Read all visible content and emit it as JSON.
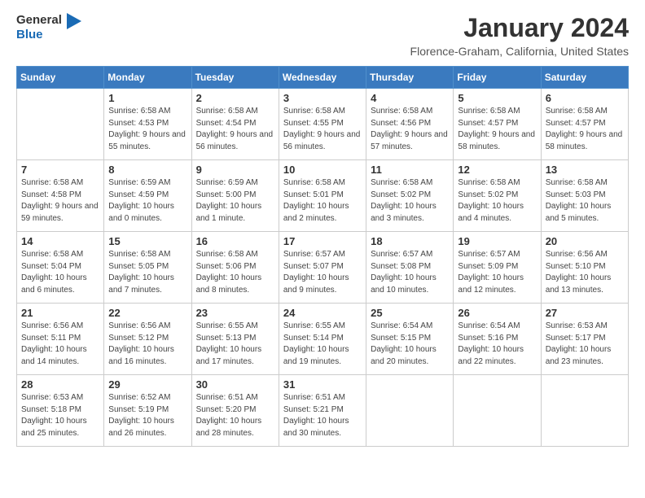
{
  "logo": {
    "text_general": "General",
    "text_blue": "Blue"
  },
  "title": "January 2024",
  "location": "Florence-Graham, California, United States",
  "weekdays": [
    "Sunday",
    "Monday",
    "Tuesday",
    "Wednesday",
    "Thursday",
    "Friday",
    "Saturday"
  ],
  "weeks": [
    [
      {
        "day": "",
        "sunrise": "",
        "sunset": "",
        "daylight": ""
      },
      {
        "day": "1",
        "sunrise": "Sunrise: 6:58 AM",
        "sunset": "Sunset: 4:53 PM",
        "daylight": "Daylight: 9 hours and 55 minutes."
      },
      {
        "day": "2",
        "sunrise": "Sunrise: 6:58 AM",
        "sunset": "Sunset: 4:54 PM",
        "daylight": "Daylight: 9 hours and 56 minutes."
      },
      {
        "day": "3",
        "sunrise": "Sunrise: 6:58 AM",
        "sunset": "Sunset: 4:55 PM",
        "daylight": "Daylight: 9 hours and 56 minutes."
      },
      {
        "day": "4",
        "sunrise": "Sunrise: 6:58 AM",
        "sunset": "Sunset: 4:56 PM",
        "daylight": "Daylight: 9 hours and 57 minutes."
      },
      {
        "day": "5",
        "sunrise": "Sunrise: 6:58 AM",
        "sunset": "Sunset: 4:57 PM",
        "daylight": "Daylight: 9 hours and 58 minutes."
      },
      {
        "day": "6",
        "sunrise": "Sunrise: 6:58 AM",
        "sunset": "Sunset: 4:57 PM",
        "daylight": "Daylight: 9 hours and 58 minutes."
      }
    ],
    [
      {
        "day": "7",
        "sunrise": "Sunrise: 6:58 AM",
        "sunset": "Sunset: 4:58 PM",
        "daylight": "Daylight: 9 hours and 59 minutes."
      },
      {
        "day": "8",
        "sunrise": "Sunrise: 6:59 AM",
        "sunset": "Sunset: 4:59 PM",
        "daylight": "Daylight: 10 hours and 0 minutes."
      },
      {
        "day": "9",
        "sunrise": "Sunrise: 6:59 AM",
        "sunset": "Sunset: 5:00 PM",
        "daylight": "Daylight: 10 hours and 1 minute."
      },
      {
        "day": "10",
        "sunrise": "Sunrise: 6:58 AM",
        "sunset": "Sunset: 5:01 PM",
        "daylight": "Daylight: 10 hours and 2 minutes."
      },
      {
        "day": "11",
        "sunrise": "Sunrise: 6:58 AM",
        "sunset": "Sunset: 5:02 PM",
        "daylight": "Daylight: 10 hours and 3 minutes."
      },
      {
        "day": "12",
        "sunrise": "Sunrise: 6:58 AM",
        "sunset": "Sunset: 5:02 PM",
        "daylight": "Daylight: 10 hours and 4 minutes."
      },
      {
        "day": "13",
        "sunrise": "Sunrise: 6:58 AM",
        "sunset": "Sunset: 5:03 PM",
        "daylight": "Daylight: 10 hours and 5 minutes."
      }
    ],
    [
      {
        "day": "14",
        "sunrise": "Sunrise: 6:58 AM",
        "sunset": "Sunset: 5:04 PM",
        "daylight": "Daylight: 10 hours and 6 minutes."
      },
      {
        "day": "15",
        "sunrise": "Sunrise: 6:58 AM",
        "sunset": "Sunset: 5:05 PM",
        "daylight": "Daylight: 10 hours and 7 minutes."
      },
      {
        "day": "16",
        "sunrise": "Sunrise: 6:58 AM",
        "sunset": "Sunset: 5:06 PM",
        "daylight": "Daylight: 10 hours and 8 minutes."
      },
      {
        "day": "17",
        "sunrise": "Sunrise: 6:57 AM",
        "sunset": "Sunset: 5:07 PM",
        "daylight": "Daylight: 10 hours and 9 minutes."
      },
      {
        "day": "18",
        "sunrise": "Sunrise: 6:57 AM",
        "sunset": "Sunset: 5:08 PM",
        "daylight": "Daylight: 10 hours and 10 minutes."
      },
      {
        "day": "19",
        "sunrise": "Sunrise: 6:57 AM",
        "sunset": "Sunset: 5:09 PM",
        "daylight": "Daylight: 10 hours and 12 minutes."
      },
      {
        "day": "20",
        "sunrise": "Sunrise: 6:56 AM",
        "sunset": "Sunset: 5:10 PM",
        "daylight": "Daylight: 10 hours and 13 minutes."
      }
    ],
    [
      {
        "day": "21",
        "sunrise": "Sunrise: 6:56 AM",
        "sunset": "Sunset: 5:11 PM",
        "daylight": "Daylight: 10 hours and 14 minutes."
      },
      {
        "day": "22",
        "sunrise": "Sunrise: 6:56 AM",
        "sunset": "Sunset: 5:12 PM",
        "daylight": "Daylight: 10 hours and 16 minutes."
      },
      {
        "day": "23",
        "sunrise": "Sunrise: 6:55 AM",
        "sunset": "Sunset: 5:13 PM",
        "daylight": "Daylight: 10 hours and 17 minutes."
      },
      {
        "day": "24",
        "sunrise": "Sunrise: 6:55 AM",
        "sunset": "Sunset: 5:14 PM",
        "daylight": "Daylight: 10 hours and 19 minutes."
      },
      {
        "day": "25",
        "sunrise": "Sunrise: 6:54 AM",
        "sunset": "Sunset: 5:15 PM",
        "daylight": "Daylight: 10 hours and 20 minutes."
      },
      {
        "day": "26",
        "sunrise": "Sunrise: 6:54 AM",
        "sunset": "Sunset: 5:16 PM",
        "daylight": "Daylight: 10 hours and 22 minutes."
      },
      {
        "day": "27",
        "sunrise": "Sunrise: 6:53 AM",
        "sunset": "Sunset: 5:17 PM",
        "daylight": "Daylight: 10 hours and 23 minutes."
      }
    ],
    [
      {
        "day": "28",
        "sunrise": "Sunrise: 6:53 AM",
        "sunset": "Sunset: 5:18 PM",
        "daylight": "Daylight: 10 hours and 25 minutes."
      },
      {
        "day": "29",
        "sunrise": "Sunrise: 6:52 AM",
        "sunset": "Sunset: 5:19 PM",
        "daylight": "Daylight: 10 hours and 26 minutes."
      },
      {
        "day": "30",
        "sunrise": "Sunrise: 6:51 AM",
        "sunset": "Sunset: 5:20 PM",
        "daylight": "Daylight: 10 hours and 28 minutes."
      },
      {
        "day": "31",
        "sunrise": "Sunrise: 6:51 AM",
        "sunset": "Sunset: 5:21 PM",
        "daylight": "Daylight: 10 hours and 30 minutes."
      },
      {
        "day": "",
        "sunrise": "",
        "sunset": "",
        "daylight": ""
      },
      {
        "day": "",
        "sunrise": "",
        "sunset": "",
        "daylight": ""
      },
      {
        "day": "",
        "sunrise": "",
        "sunset": "",
        "daylight": ""
      }
    ]
  ]
}
